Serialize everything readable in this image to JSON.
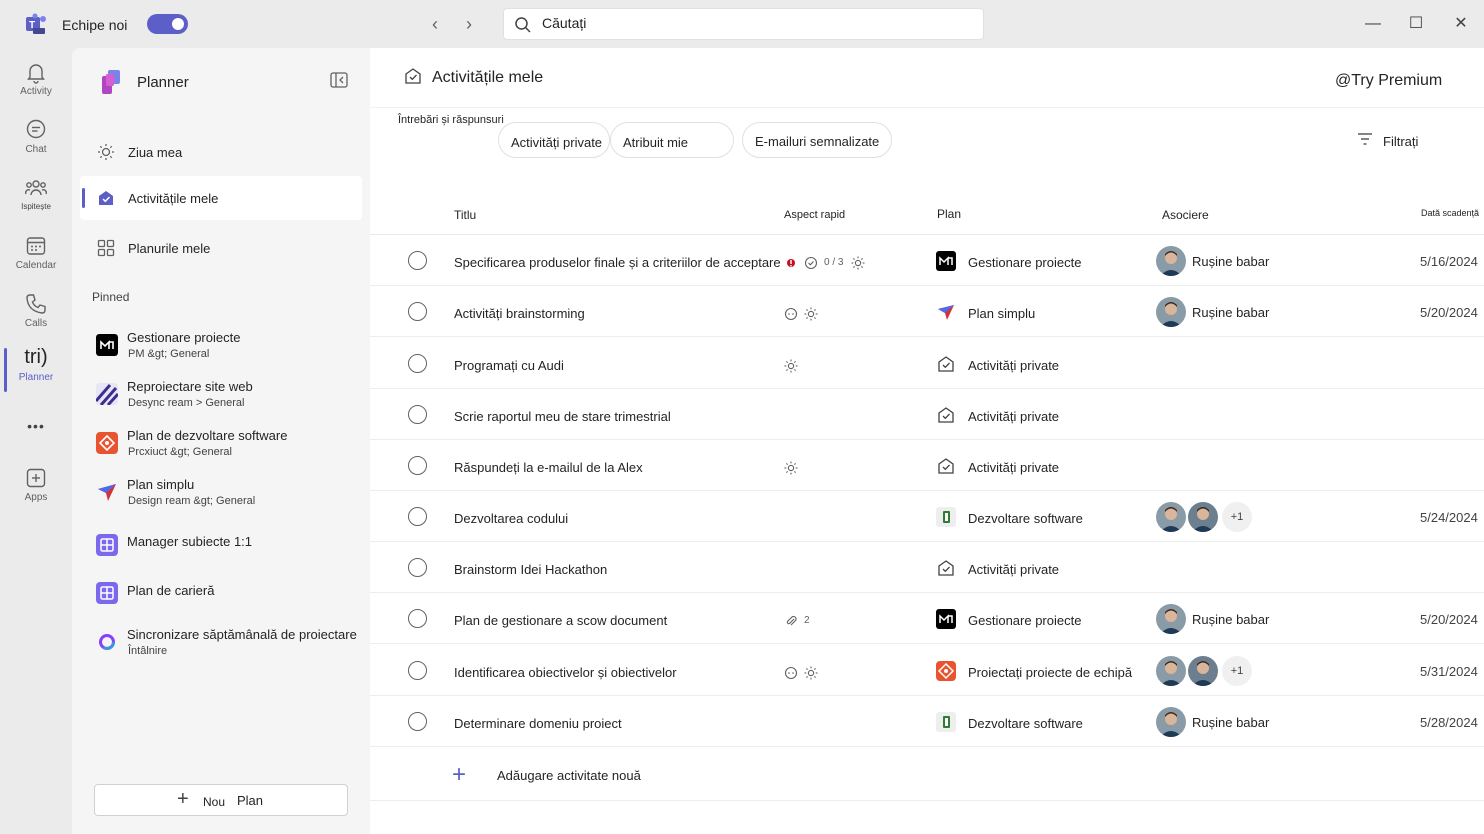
{
  "titlebar": {
    "app_name": "Echipe noi",
    "toggle_on": true,
    "back_icon": "chevron-left-icon",
    "forward_icon": "chevron-right-icon",
    "search_placeholder": "Căutați",
    "minimize": "—",
    "maximize": "☐",
    "close": "✕"
  },
  "rail": {
    "items": [
      {
        "label": "Activity",
        "icon": "bell-icon"
      },
      {
        "label": "Chat",
        "icon": "chat-icon"
      },
      {
        "label": "Ispitește",
        "icon": "teams-icon"
      },
      {
        "label": "Calendar",
        "icon": "calendar-icon"
      },
      {
        "label": "Calls",
        "icon": "phone-icon"
      },
      {
        "label": "Planner",
        "icon_text": "tri)",
        "active": true
      },
      {
        "label": "",
        "icon_text": "•••"
      },
      {
        "label": "Apps",
        "icon": "plus-box-icon"
      }
    ]
  },
  "sidebar": {
    "title": "Planner",
    "nav": [
      {
        "label": "Ziua mea",
        "icon": "sun-icon"
      },
      {
        "label": "Activitățile mele",
        "icon": "my-tasks-icon",
        "active": true
      },
      {
        "label": "Planurile mele",
        "icon": "grid-icon"
      }
    ],
    "pinned_label": "Pinned",
    "pinned": [
      {
        "title": "Gestionare proiecte",
        "sub": "PM &gt; General",
        "icon": "project-manager-icon",
        "color": "#000000"
      },
      {
        "title": "Reproiectare site web",
        "sub": "Desync ream  >  General",
        "icon": "stripes-icon",
        "color": "#3b2e8f"
      },
      {
        "title": "Plan de dezvoltare software",
        "sub": "Prcxiuct &gt; General",
        "icon": "software-icon",
        "color": "#e8542f"
      },
      {
        "title": "Plan simplu",
        "sub": "Design ream &gt; General",
        "icon": "paper-plane-icon",
        "color": "#ffffff"
      },
      {
        "title": "Manager subiecte 1:1",
        "sub": "",
        "icon": "board-icon",
        "color": "#7b68ee"
      },
      {
        "title": "Plan de carieră",
        "sub": "",
        "icon": "board-icon",
        "color": "#7b68ee"
      },
      {
        "title": "Sincronizare săptămânală de proiectare",
        "sub": "Întâlnire",
        "icon": "loop-icon",
        "color": "#ffffff"
      }
    ],
    "new_plan_word1": "Nou",
    "new_plan_word2": "Plan"
  },
  "main": {
    "title": "Activitățile mele",
    "premium": "@Try Premium",
    "qa_label": "Întrebări și răspunsuri",
    "chips": [
      "Activități private",
      "Atribuit mie",
      "E-mailuri semnalizate"
    ],
    "filter_label": "Filtrați",
    "columns": {
      "title": "Titlu",
      "quick": "Aspect rapid",
      "plan": "Plan",
      "assign": "Asociere",
      "due": "Dată scadență"
    },
    "rows": [
      {
        "title": "Specificarea produselor finale și a criteriilor de acceptare",
        "quick": [
          {
            "icon": "priority-icon"
          },
          {
            "icon": "checklist-icon",
            "text": "0 / 3"
          },
          {
            "icon": "sun-icon"
          }
        ],
        "plan": "Gestionare proiecte",
        "plan_icon": "project-manager-icon",
        "plan_color": "#000000",
        "assignees": 1,
        "assignee_name": "Rușine babar",
        "more": "",
        "date": "5/16/2024"
      },
      {
        "title": "Activități brainstorming",
        "quick": [
          {
            "icon": "comment-icon"
          },
          {
            "icon": "sun-icon"
          }
        ],
        "plan": "Plan simplu",
        "plan_icon": "paper-plane-icon",
        "plan_color": "#ffffff",
        "assignees": 1,
        "assignee_name": "Rușine babar",
        "more": "",
        "date": "5/20/2024"
      },
      {
        "title": "Programați cu Audi",
        "quick": [
          {
            "icon": "sun-icon"
          }
        ],
        "plan": "Activități private",
        "plan_icon": "my-tasks-icon",
        "plan_color": "#ffffff",
        "assignees": 0,
        "assignee_name": "",
        "more": "",
        "date": ""
      },
      {
        "title": "Scrie raportul meu de stare trimestrial",
        "quick": [],
        "plan": "Activități private",
        "plan_icon": "my-tasks-icon",
        "plan_color": "#ffffff",
        "assignees": 0,
        "assignee_name": "",
        "more": "",
        "date": ""
      },
      {
        "title": "Răspundeți la e-mailul de la Alex",
        "quick": [
          {
            "icon": "sun-icon"
          }
        ],
        "plan": "Activități private",
        "plan_icon": "my-tasks-icon",
        "plan_color": "#ffffff",
        "assignees": 0,
        "assignee_name": "",
        "more": "",
        "date": ""
      },
      {
        "title": "Dezvoltarea codului",
        "quick": [],
        "plan": "Dezvoltare software",
        "plan_icon": "software-dev-icon",
        "plan_color": "#eeeeee",
        "assignees": 2,
        "assignee_name": "",
        "more": "+1",
        "date": "5/24/2024"
      },
      {
        "title": "Brainstorm Idei Hackathon",
        "quick": [],
        "plan": "Activități private",
        "plan_icon": "my-tasks-icon",
        "plan_color": "#ffffff",
        "assignees": 0,
        "assignee_name": "",
        "more": "",
        "date": ""
      },
      {
        "title": "Plan de gestionare a scow document",
        "quick": [
          {
            "icon": "attachment-icon",
            "text": "2"
          }
        ],
        "plan": "Gestionare proiecte",
        "plan_icon": "project-manager-icon",
        "plan_color": "#000000",
        "assignees": 1,
        "assignee_name": "Rușine babar",
        "more": "",
        "date": "5/20/2024"
      },
      {
        "title": "Identificarea obiectivelor și obiectivelor",
        "quick": [
          {
            "icon": "comment-icon"
          },
          {
            "icon": "sun-icon"
          }
        ],
        "plan": "Proiectați proiecte de echipă",
        "plan_icon": "software-icon",
        "plan_color": "#e8542f",
        "assignees": 2,
        "assignee_name": "",
        "more": "+1",
        "date": "5/31/2024"
      },
      {
        "title": "Determinare domeniu proiect",
        "quick": [],
        "plan": "Dezvoltare software",
        "plan_icon": "software-dev-icon",
        "plan_color": "#eeeeee",
        "assignees": 1,
        "assignee_name": "Rușine babar",
        "more": "",
        "date": "5/28/2024"
      }
    ],
    "add_task_label": "Adăugare activitate nouă"
  },
  "colors": {
    "accent": "#5b5fc7",
    "frame": "#ebebeb",
    "sidebar": "#f5f5f5"
  }
}
